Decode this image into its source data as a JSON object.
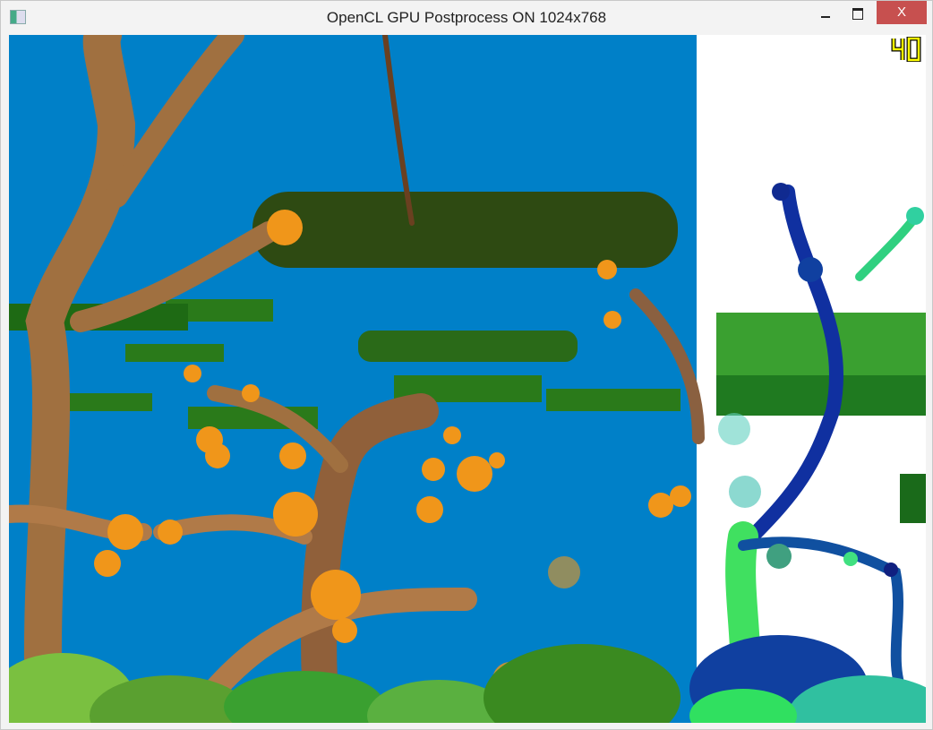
{
  "window": {
    "title": "OpenCL GPU Postprocess ON  1024x768",
    "close_label": "X"
  },
  "overlay": {
    "fps": "40"
  },
  "colors": {
    "sky": "#0080c8",
    "fps": "#ffff00",
    "close": "#c7504f",
    "panel": "#ffffff"
  }
}
